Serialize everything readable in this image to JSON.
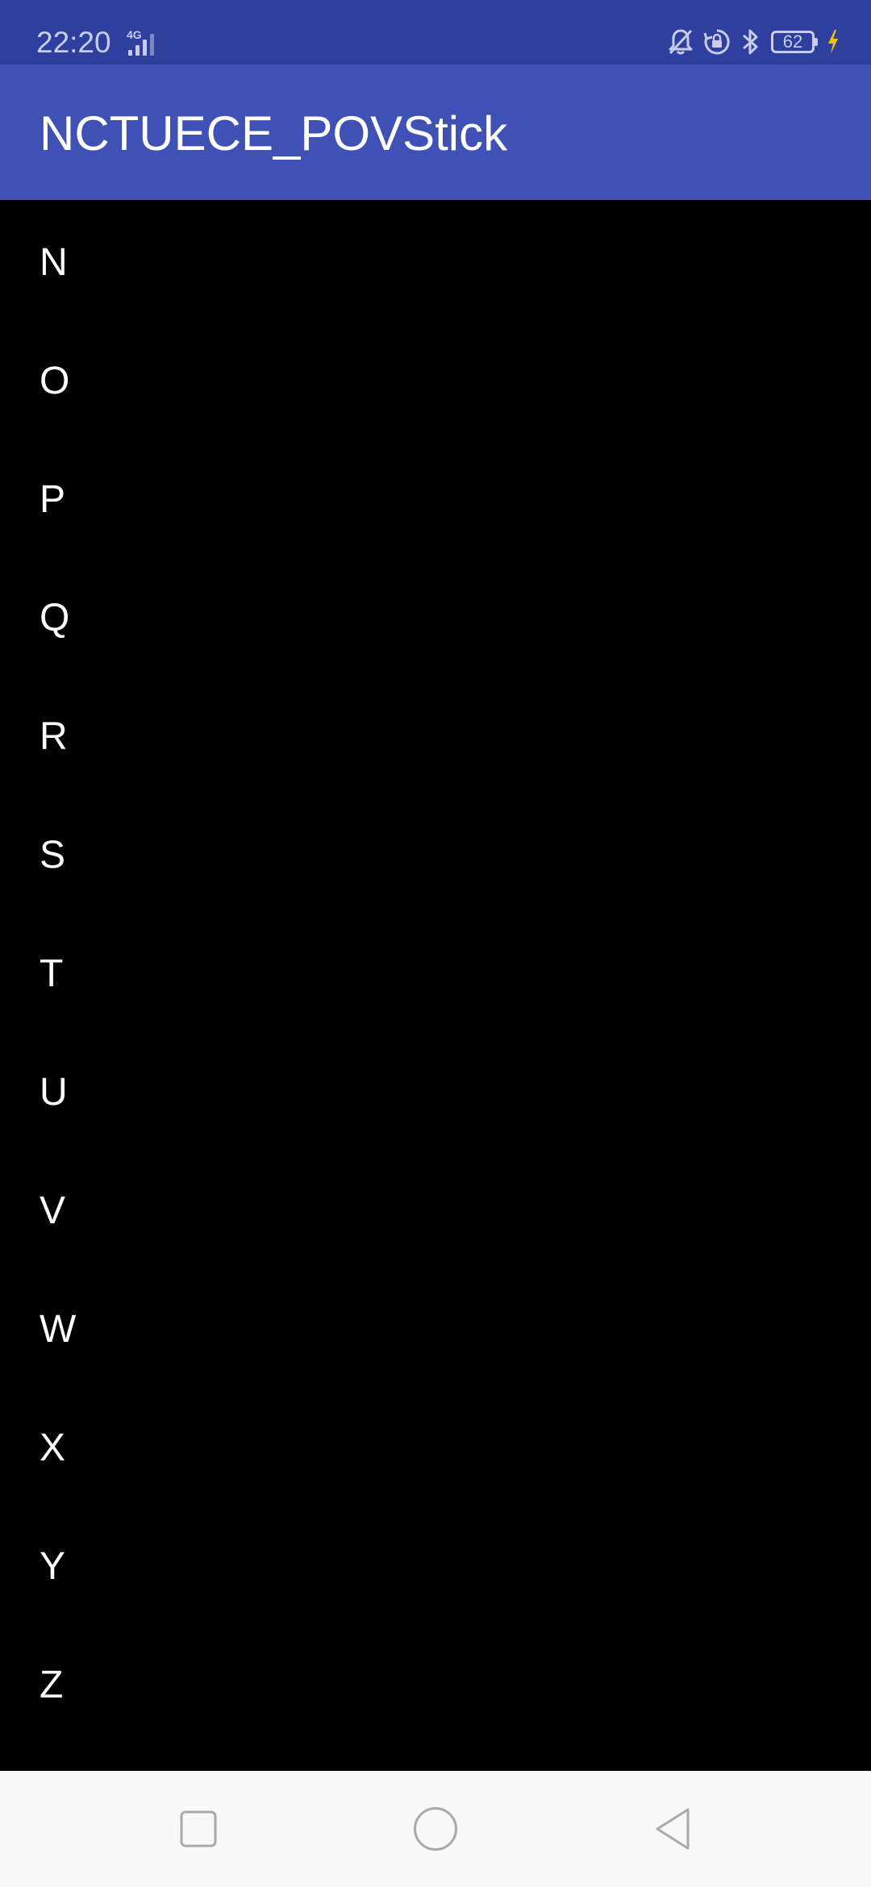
{
  "status_bar": {
    "time": "22:20",
    "network": "4G",
    "battery_level": "62",
    "icons": [
      "bell-off-icon",
      "rotation-lock-icon",
      "bluetooth-icon",
      "battery-icon",
      "charging-bolt-icon"
    ],
    "colors": {
      "background": "#2E3FA0",
      "foreground": "#C9CDEB",
      "charging": "#F5C400"
    }
  },
  "app_bar": {
    "title": "NCTUECE_POVStick",
    "background": "#3F51B5"
  },
  "list": {
    "items": [
      {
        "label": "N"
      },
      {
        "label": "O"
      },
      {
        "label": "P"
      },
      {
        "label": "Q"
      },
      {
        "label": "R"
      },
      {
        "label": "S"
      },
      {
        "label": "T"
      },
      {
        "label": "U"
      },
      {
        "label": "V"
      },
      {
        "label": "W"
      },
      {
        "label": "X"
      },
      {
        "label": "Y"
      },
      {
        "label": "Z"
      }
    ]
  },
  "nav_bar": {
    "buttons": [
      "recents-icon",
      "home-icon",
      "back-icon"
    ],
    "background": "#F8F8F8"
  }
}
